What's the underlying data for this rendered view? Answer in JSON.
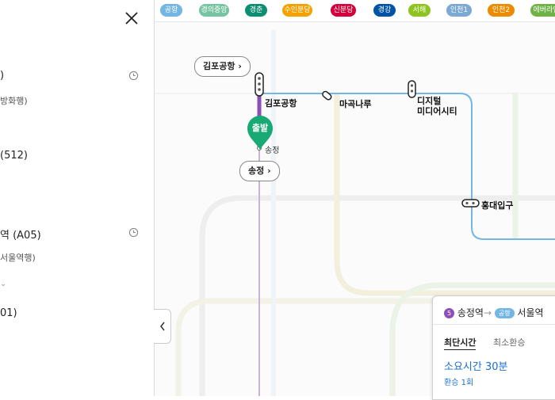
{
  "panel": {
    "items": [
      {
        "title": ")",
        "subtitle": "방화행)"
      },
      {
        "title": "(512)",
        "subtitle": ""
      },
      {
        "title": "역 (A05)",
        "subtitle": "서울역행)"
      },
      {
        "title": "01)",
        "subtitle": ""
      }
    ],
    "more_glyph": "⌄"
  },
  "line_tabs": [
    {
      "label": "공항",
      "color": "#73b6e4"
    },
    {
      "label": "경의중앙",
      "color": "#77c4a3"
    },
    {
      "label": "경춘",
      "color": "#0c8e72"
    },
    {
      "label": "수인분당",
      "color": "#f5a200"
    },
    {
      "label": "신분당",
      "color": "#d4003b"
    },
    {
      "label": "경강",
      "color": "#0054a6"
    },
    {
      "label": "서해",
      "color": "#8fc31f"
    },
    {
      "label": "인천1",
      "color": "#7ca8d5"
    },
    {
      "label": "인천2",
      "color": "#ed8b00"
    },
    {
      "label": "에버라인",
      "color": "#6fb245"
    }
  ],
  "map": {
    "pills": {
      "gimpo": "김포공항",
      "songjeong": "송정"
    },
    "stations": {
      "gimpo": "김포공항",
      "magongnaru": "마곡나루",
      "dmc_line1": "디지털",
      "dmc_line2": "미디어시티",
      "hongdae": "홍대입구",
      "songjeong": "송정"
    },
    "depart_label": "출발",
    "colors": {
      "airport": "#73b6e4",
      "line5": "#8b4fb7",
      "depart": "#19a974"
    }
  },
  "route_card": {
    "from_line_num": "5",
    "from_station": "송정역",
    "arrow": "→",
    "to_line": "공항",
    "to_station": "서울역",
    "tab_fastest": "최단시간",
    "tab_fewest_transfer": "최소환승",
    "duration": "소요시간 30분",
    "transfers": "환승 1회"
  }
}
